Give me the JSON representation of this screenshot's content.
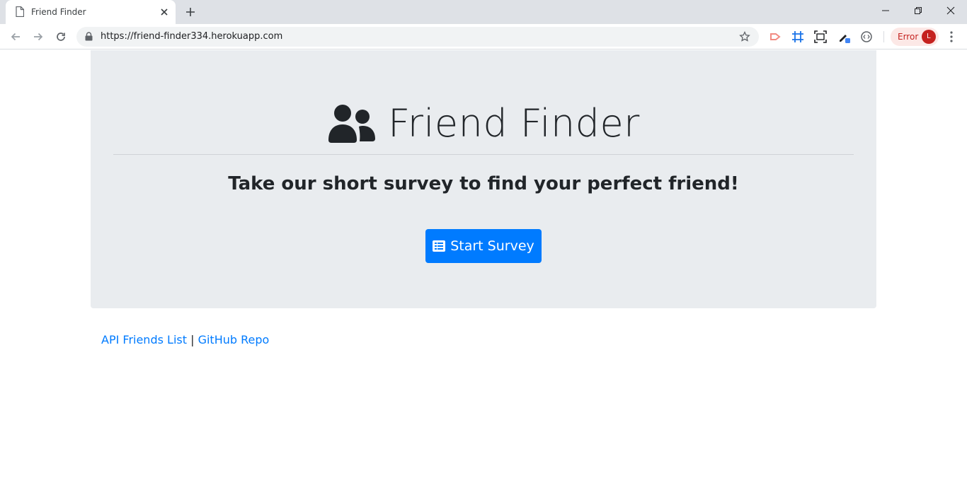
{
  "browser": {
    "tab_title": "Friend Finder",
    "url": "https://friend-finder334.herokuapp.com",
    "error_label": "Error",
    "profile_initial": "L",
    "icons": [
      "page-icon",
      "close-icon",
      "plus-icon",
      "minimize-icon",
      "restore-icon",
      "window-close-icon",
      "back-arrow-icon",
      "forward-arrow-icon",
      "reload-icon",
      "lock-icon",
      "star-icon",
      "kebab-menu-icon"
    ],
    "colors": {
      "tabbar": "#dee1e6",
      "omnibox": "#f1f3f4",
      "error_chip": "#fce8e6",
      "error_text": "#c5221f"
    }
  },
  "page": {
    "title": "Friend Finder",
    "title_icon": "users-icon",
    "tagline": "Take our short survey to find your perfect friend!",
    "start_button": {
      "label": "Start Survey",
      "icon": "list-alt-icon"
    },
    "footer": {
      "api_link": "API Friends List",
      "separator": "|",
      "github_link": "GitHub Repo"
    },
    "colors": {
      "jumbotron": "#e9ecef",
      "primary": "#007bff",
      "text": "#212529"
    }
  }
}
